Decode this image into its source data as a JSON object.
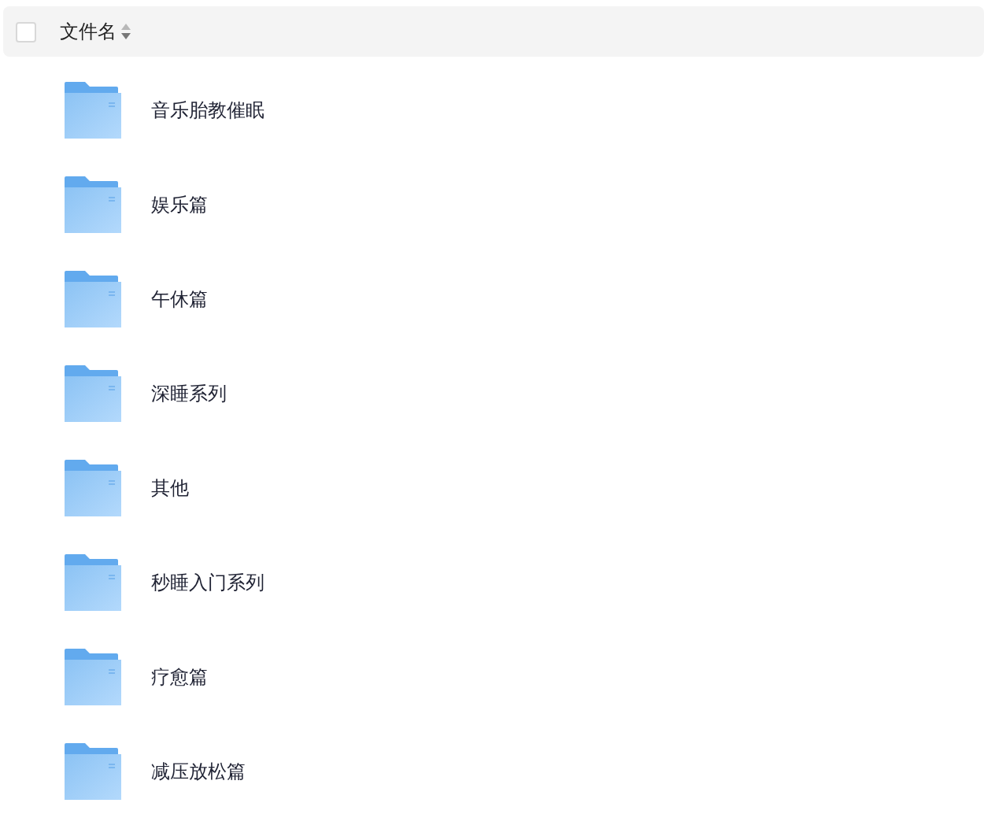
{
  "header": {
    "select_all": {
      "checked": false
    },
    "column_label": "文件名"
  },
  "files": [
    {
      "name": "音乐胎教催眠"
    },
    {
      "name": "娱乐篇"
    },
    {
      "name": "午休篇"
    },
    {
      "name": "深睡系列"
    },
    {
      "name": "其他"
    },
    {
      "name": "秒睡入门系列"
    },
    {
      "name": "疗愈篇"
    },
    {
      "name": "减压放松篇"
    }
  ]
}
